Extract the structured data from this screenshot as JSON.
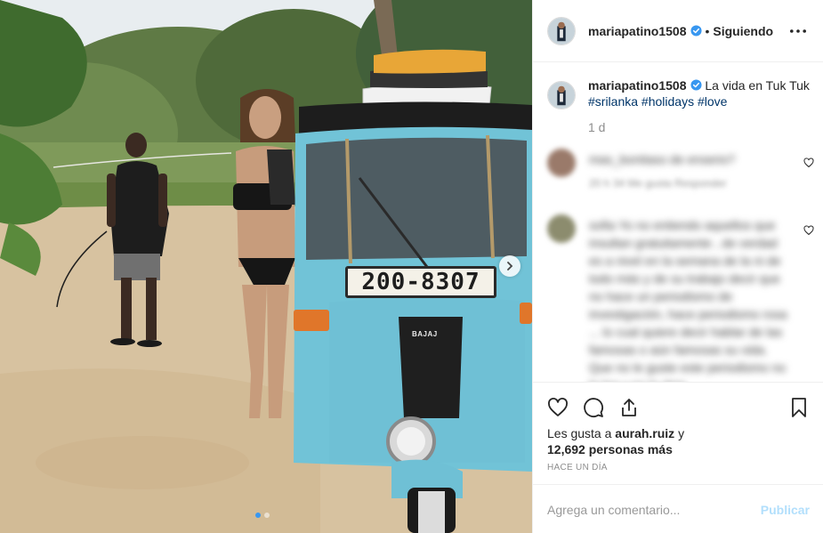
{
  "post": {
    "image": {
      "license_plate": "200-8307",
      "vehicle_brand": "BAJAJ",
      "carousel_total": 2,
      "carousel_active": 1
    },
    "header": {
      "username": "mariapatino1508",
      "separator": "•",
      "follow_status": "Siguiendo"
    },
    "caption": {
      "username": "mariapatino1508",
      "text": "La vida en Tuk Tuk",
      "hashtags": "#srilanka #holidays #love",
      "time_ago": "1 d"
    },
    "comments": [
      {
        "text": "mas_bonitaso de enserio?",
        "meta": "20 h    34 Me gusta    Responder"
      },
      {
        "text": "sofia Yo no entiendo aquellos que insultan gratuitamente , de verdad es a nivel en la semana de la ni de todo más y de su trabajo decir que no hace un periodismo de investigación, hace periodismo rosa ... lo cual quiere decir hablar de las famosas o aún famosas su vida. Que no le guste este periodismo no le lea y no lo deja",
        "meta": ""
      }
    ],
    "likes": {
      "prefix": "Les gusta a",
      "first_user": "aurah.ruiz",
      "connector": "y",
      "others": "12,692 personas más"
    },
    "timestamp": "HACE UN DÍA",
    "comment_box": {
      "placeholder": "Agrega un comentario...",
      "publish_label": "Publicar"
    },
    "colors": {
      "verified": "#3897f0",
      "hashtag": "#003569",
      "publish_disabled": "#b2dffc",
      "secondary_text": "#8e8e8e"
    }
  }
}
